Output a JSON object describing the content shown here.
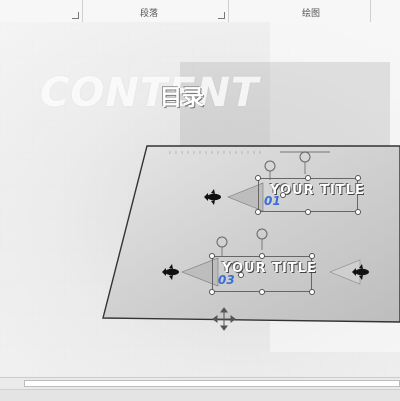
{
  "ribbon": {
    "groups": [
      {
        "label": "段落"
      },
      {
        "label": "绘图"
      }
    ]
  },
  "slide": {
    "bg_word": "CONTENT",
    "heading": "目录",
    "items": [
      {
        "title": "YOUR TITLE",
        "number": "01"
      },
      {
        "title": "YOUR TITLE",
        "number": "03"
      }
    ]
  },
  "icons": {
    "rocket": "rocket-icon",
    "rotate": "rotate-handle-icon",
    "move": "move-cursor-icon",
    "launcher": "dialog-launcher-icon"
  },
  "colors": {
    "number_blue": "#3a6fd4",
    "panel_fill": "#d6d6d6"
  }
}
